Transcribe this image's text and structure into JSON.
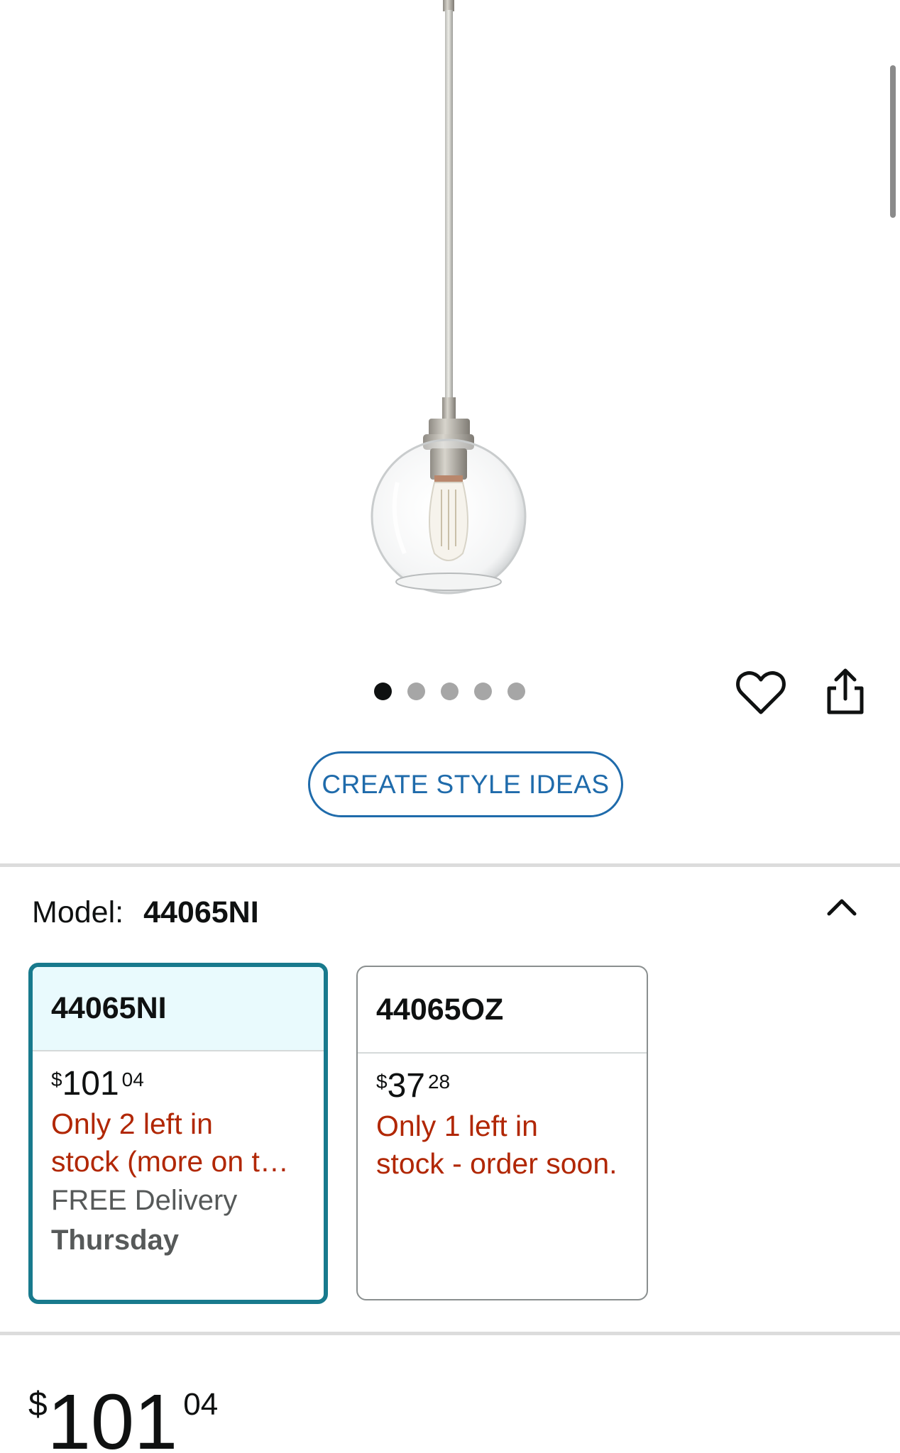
{
  "product": {
    "image_alt": "pendant light"
  },
  "gallery": {
    "dots_total": 5,
    "active_index": 0
  },
  "actions": {
    "wishlist_icon": "heart-icon",
    "share_icon": "share-icon",
    "style_ideas_label": "CREATE STYLE IDEAS"
  },
  "model": {
    "label": "Model:",
    "value": "44065NI",
    "toggle_icon": "chevron-up-icon"
  },
  "variants": [
    {
      "name": "44065NI",
      "price_symbol": "$",
      "price_whole": "101",
      "price_fraction": "04",
      "stock_line1": "Only 2 left in",
      "stock_line2": "stock (more on t…",
      "delivery": "FREE Delivery",
      "delivery_day": "Thursday",
      "selected": true
    },
    {
      "name": "44065OZ",
      "price_symbol": "$",
      "price_whole": "37",
      "price_fraction": "28",
      "stock_line1": "Only 1 left in",
      "stock_line2": "stock - order soon.",
      "selected": false
    }
  ],
  "price": {
    "symbol": "$",
    "whole": "101",
    "fraction": "04"
  },
  "colors": {
    "accent_blue": "#1f6bab",
    "selected_border": "#187a8d",
    "selected_header_bg": "#e9fafd",
    "stock_red": "#b12704"
  }
}
